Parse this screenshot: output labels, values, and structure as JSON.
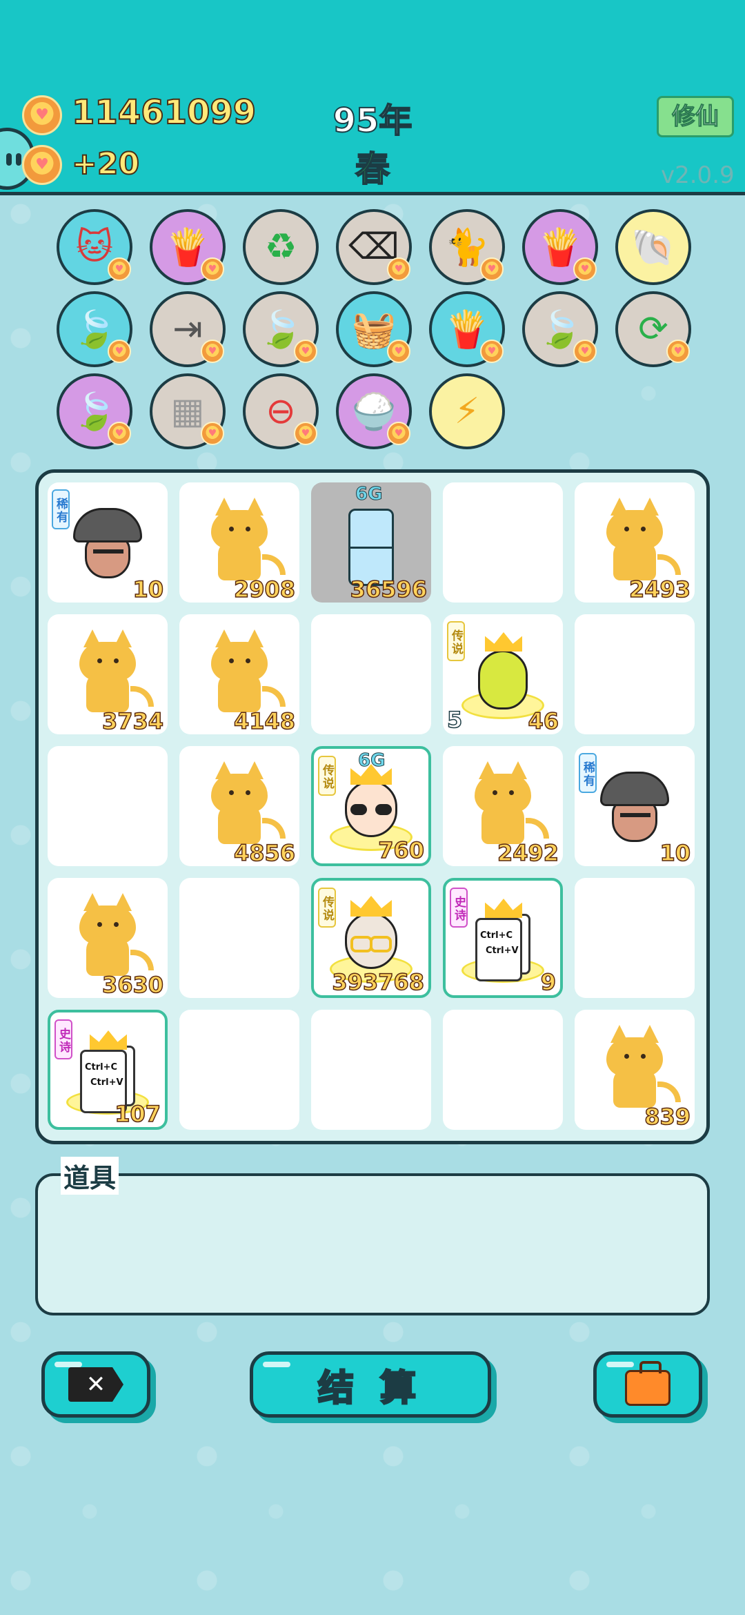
{
  "header": {
    "coins_total": "11461099",
    "coins_rate": "+20",
    "year": "95年",
    "season": "春",
    "cultivate_button": "修仙",
    "version": "v2.0.9"
  },
  "buffs": [
    {
      "icon": "cat-silhouette-icon",
      "color": "blue"
    },
    {
      "icon": "fries-icon",
      "color": "purple"
    },
    {
      "icon": "recycle-icon",
      "color": "gray"
    },
    {
      "icon": "delete-tag-icon",
      "color": "gray"
    },
    {
      "icon": "twin-cats-icon",
      "color": "gray"
    },
    {
      "icon": "fries-icon",
      "color": "purple"
    },
    {
      "icon": "shell-icon",
      "color": "yellow"
    },
    {
      "icon": "leaf-icon",
      "color": "blue"
    },
    {
      "icon": "skip-icon",
      "color": "gray"
    },
    {
      "icon": "leaf-icon",
      "color": "gray"
    },
    {
      "icon": "basket-icon",
      "color": "blue"
    },
    {
      "icon": "fries-icon",
      "color": "blue"
    },
    {
      "icon": "leaf-icon",
      "color": "gray"
    },
    {
      "icon": "refresh-icon",
      "color": "gray"
    },
    {
      "icon": "leaf-icon",
      "color": "purple"
    },
    {
      "icon": "sugar-cubes-icon",
      "color": "gray"
    },
    {
      "icon": "minus-circle-icon",
      "color": "gray"
    },
    {
      "icon": "rice-bowl-icon",
      "color": "purple"
    },
    {
      "icon": "lightning-icon",
      "color": "yellow"
    }
  ],
  "board": {
    "cells": [
      {
        "item": "person",
        "badge": "稀有",
        "badge_type": "rare",
        "count": "10"
      },
      {
        "item": "cat",
        "count": "2908"
      },
      {
        "item": "fridge",
        "tag": "6G",
        "count": "36596",
        "grayed": true
      },
      {
        "item": "empty"
      },
      {
        "item": "cat",
        "count": "2493"
      },
      {
        "item": "cat",
        "count": "3734"
      },
      {
        "item": "cat",
        "count": "4148"
      },
      {
        "item": "empty"
      },
      {
        "item": "pear",
        "badge": "传说",
        "badge_type": "legend",
        "count": "46",
        "left_count": "5"
      },
      {
        "item": "empty"
      },
      {
        "item": "empty"
      },
      {
        "item": "cat",
        "count": "4856"
      },
      {
        "item": "king",
        "badge": "传说",
        "badge_type": "legend",
        "tag": "6G",
        "count": "760",
        "highlight": true
      },
      {
        "item": "cat",
        "count": "2492"
      },
      {
        "item": "person",
        "badge": "稀有",
        "badge_type": "rare",
        "count": "10"
      },
      {
        "item": "cat",
        "count": "3630"
      },
      {
        "item": "empty"
      },
      {
        "item": "king-gold",
        "badge": "传说",
        "badge_type": "legend",
        "count": "393768",
        "highlight": true
      },
      {
        "item": "copycard",
        "badge": "史诗",
        "badge_type": "epic",
        "count": "9",
        "highlight": true
      },
      {
        "item": "empty"
      },
      {
        "item": "copycard",
        "badge": "史诗",
        "badge_type": "epic",
        "count": "107",
        "highlight": true
      },
      {
        "item": "empty"
      },
      {
        "item": "empty"
      },
      {
        "item": "empty"
      },
      {
        "item": "cat",
        "count": "839"
      }
    ],
    "copy_text_1": "Ctrl+C",
    "copy_text_2": "Ctrl+V"
  },
  "props": {
    "label": "道具"
  },
  "buttons": {
    "remove_icon": "x-tag-icon",
    "settle_label": "结 算",
    "bag_icon": "briefcase-icon"
  }
}
